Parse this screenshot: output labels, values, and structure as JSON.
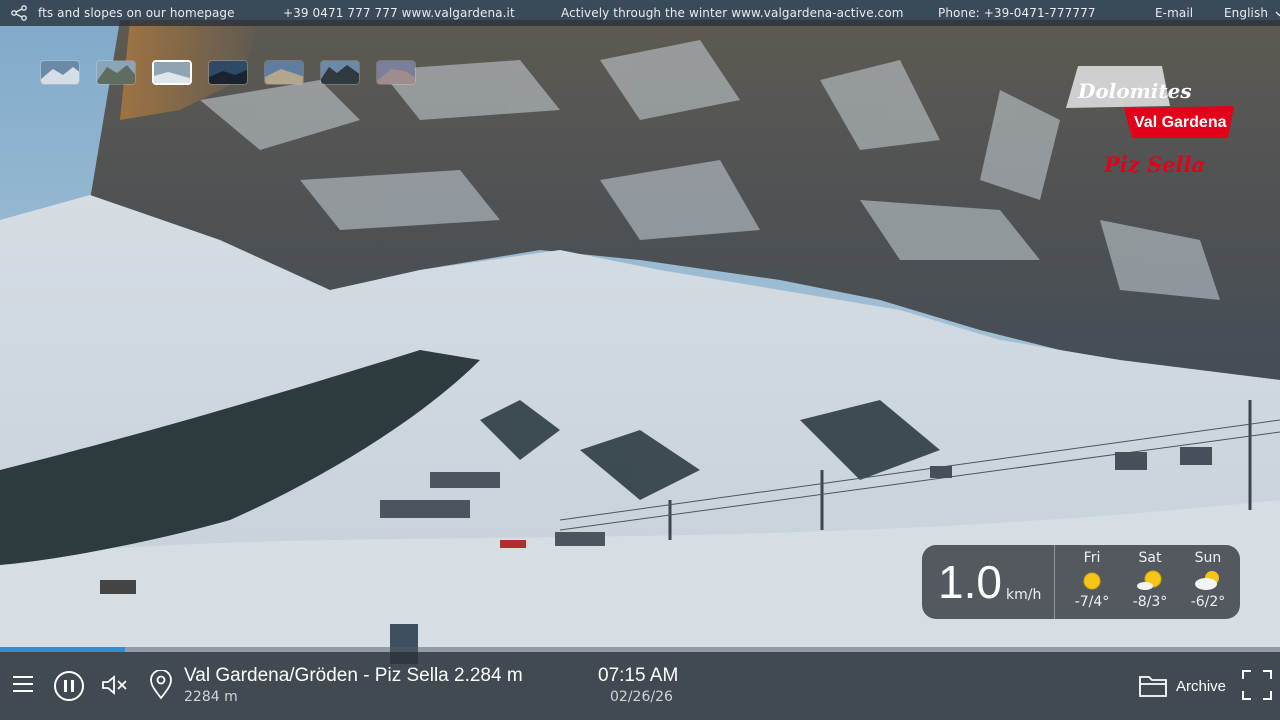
{
  "topbar": {
    "ticker_1": "fts and slopes on our homepage",
    "ticker_2": "+39 0471 777 777 www.valgardena.it",
    "ticker_3": "Actively through the winter www.valgardena-active.com",
    "phone": "Phone: +39-0471-777777",
    "email_link": "E-mail",
    "language": "English",
    "share_icon": "share-icon",
    "language_icon": "chevron-down-icon"
  },
  "thumbnails": {
    "count": 7,
    "active_index": 2
  },
  "logo": {
    "line1": "Dolomites",
    "line2": "Val Gardena",
    "line3": "Piz Sella"
  },
  "weather": {
    "wind_value": "1.0",
    "wind_unit": "km/h",
    "days": [
      {
        "name": "Fri",
        "temp": "-7/4°",
        "icon": "sun-icon"
      },
      {
        "name": "Sat",
        "temp": "-8/3°",
        "icon": "sun-cloud-icon"
      },
      {
        "name": "Sun",
        "temp": "-6/2°",
        "icon": "cloud-sun-icon"
      }
    ]
  },
  "player": {
    "progress": 0.098,
    "location_title": "Val Gardena/Gröden - Piz Sella 2.284 m",
    "location_sub": "2284 m",
    "time": "07:15 AM",
    "date": "02/26/26",
    "archive_label": "Archive",
    "icons": {
      "menu": "menu-icon",
      "pause": "pause-icon",
      "mute": "mute-icon",
      "location": "location-pin-icon",
      "archive": "folder-icon",
      "fullscreen": "fullscreen-icon"
    }
  },
  "colors": {
    "accent": "#2f8fd6",
    "logo_red": "#e3001b",
    "bar_bg": "#2c343c"
  }
}
